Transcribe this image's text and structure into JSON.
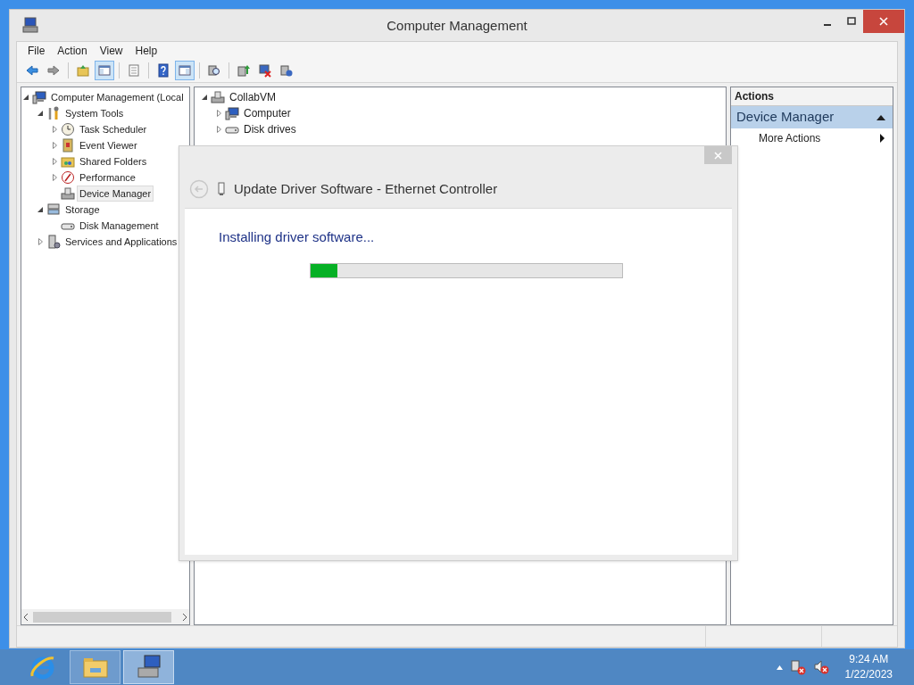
{
  "window": {
    "title": "Computer Management"
  },
  "menu": [
    "File",
    "Action",
    "View",
    "Help"
  ],
  "toolbar": [
    {
      "kind": "back",
      "selected": false
    },
    {
      "kind": "forward",
      "selected": false
    },
    {
      "kind": "up",
      "selected": false
    },
    {
      "kind": "tree",
      "selected": true
    },
    {
      "kind": "properties",
      "selected": false
    },
    {
      "kind": "help",
      "selected": false
    },
    {
      "kind": "actionpane",
      "selected": true
    },
    {
      "kind": "scan",
      "selected": false
    },
    {
      "kind": "update",
      "selected": false
    },
    {
      "kind": "disable",
      "selected": false
    },
    {
      "kind": "uninstall",
      "selected": false
    }
  ],
  "console_tree": [
    {
      "label": "Computer Management (Local",
      "kind": "computer",
      "expanded": true,
      "selected": false,
      "children": [
        {
          "label": "System Tools",
          "kind": "tools",
          "expanded": true,
          "selected": false,
          "children": [
            {
              "label": "Task Scheduler",
              "kind": "clock",
              "expanded": false,
              "selected": false
            },
            {
              "label": "Event Viewer",
              "kind": "log",
              "expanded": false,
              "selected": false
            },
            {
              "label": "Shared Folders",
              "kind": "share",
              "expanded": false,
              "selected": false
            },
            {
              "label": "Performance",
              "kind": "gauge",
              "expanded": false,
              "selected": false
            },
            {
              "label": "Device Manager",
              "kind": "device",
              "selected": true
            }
          ]
        },
        {
          "label": "Storage",
          "kind": "storage",
          "expanded": true,
          "selected": false,
          "children": [
            {
              "label": "Disk Management",
              "kind": "disk",
              "selected": false
            }
          ]
        },
        {
          "label": "Services and Applications",
          "kind": "services",
          "expanded": false,
          "selected": false
        }
      ]
    }
  ],
  "device_tree": [
    {
      "label": "CollabVM",
      "kind": "device",
      "expanded": true,
      "selected": false,
      "children": [
        {
          "label": "Computer",
          "kind": "computer",
          "expanded": false,
          "selected": false
        },
        {
          "label": "Disk drives",
          "kind": "disk",
          "expanded": false,
          "selected": false
        }
      ]
    }
  ],
  "actions": {
    "header": "Actions",
    "section": "Device Manager",
    "items": [
      {
        "label": "More Actions"
      }
    ]
  },
  "dialog": {
    "title": "Update Driver Software - Ethernet Controller",
    "message": "Installing driver software...",
    "progress": {
      "level": 0.086
    }
  },
  "taskbar": {
    "apps": [
      {
        "kind": "ie",
        "selected": false
      },
      {
        "kind": "explorer",
        "selected": false
      },
      {
        "kind": "compmgmt",
        "selected": true
      }
    ],
    "time": "9:24 AM",
    "date": "1/22/2023"
  }
}
